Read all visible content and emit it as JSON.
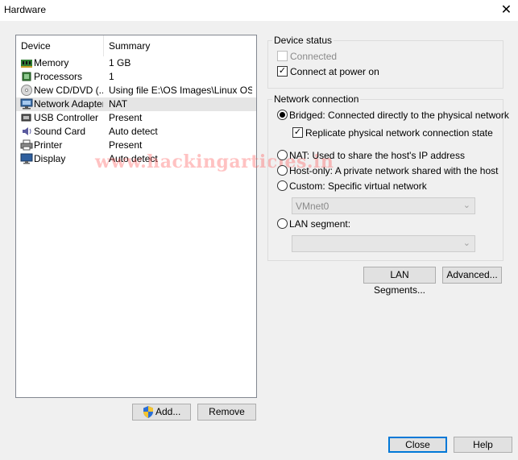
{
  "window": {
    "title": "Hardware",
    "close_glyph": "✕"
  },
  "device_list": {
    "columns": {
      "device": "Device",
      "summary": "Summary"
    },
    "rows": [
      {
        "name": "Memory",
        "summary": "1 GB",
        "icon": "memory-icon",
        "selected": false
      },
      {
        "name": "Processors",
        "summary": "1",
        "icon": "processor-icon",
        "selected": false
      },
      {
        "name": "New CD/DVD (...",
        "summary": "Using file E:\\OS Images\\Linux OS\\...",
        "icon": "cd-dvd-icon",
        "selected": false
      },
      {
        "name": "Network Adapter",
        "summary": "NAT",
        "icon": "network-adapter-icon",
        "selected": true
      },
      {
        "name": "USB Controller",
        "summary": "Present",
        "icon": "usb-icon",
        "selected": false
      },
      {
        "name": "Sound Card",
        "summary": "Auto detect",
        "icon": "sound-card-icon",
        "selected": false
      },
      {
        "name": "Printer",
        "summary": "Present",
        "icon": "printer-icon",
        "selected": false
      },
      {
        "name": "Display",
        "summary": "Auto detect",
        "icon": "display-icon",
        "selected": false
      }
    ]
  },
  "watermark": "www.hackingarticles.in",
  "buttons": {
    "add": "Add...",
    "remove": "Remove",
    "lan_segments": "LAN Segments...",
    "advanced": "Advanced...",
    "close": "Close",
    "help": "Help"
  },
  "device_status": {
    "title": "Device status",
    "connected": {
      "label": "Connected",
      "checked": false,
      "disabled": true
    },
    "connect_at_power_on": {
      "label": "Connect at power on",
      "checked": true
    }
  },
  "network_connection": {
    "title": "Network connection",
    "bridged": {
      "label": "Bridged: Connected directly to the physical network",
      "selected": true
    },
    "replicate": {
      "label": "Replicate physical network connection state",
      "checked": true
    },
    "nat": {
      "label": "NAT: Used to share the host's IP address",
      "selected": false
    },
    "host_only": {
      "label": "Host-only: A private network shared with the host",
      "selected": false
    },
    "custom": {
      "label": "Custom: Specific virtual network",
      "selected": false
    },
    "custom_select": {
      "value": "VMnet0"
    },
    "lan_segment": {
      "label": "LAN segment:",
      "selected": false
    },
    "lan_select": {
      "value": ""
    }
  },
  "colors": {
    "selection": "#e5e5e5",
    "accent": "#0078d7",
    "watermark": "#ff5050"
  }
}
